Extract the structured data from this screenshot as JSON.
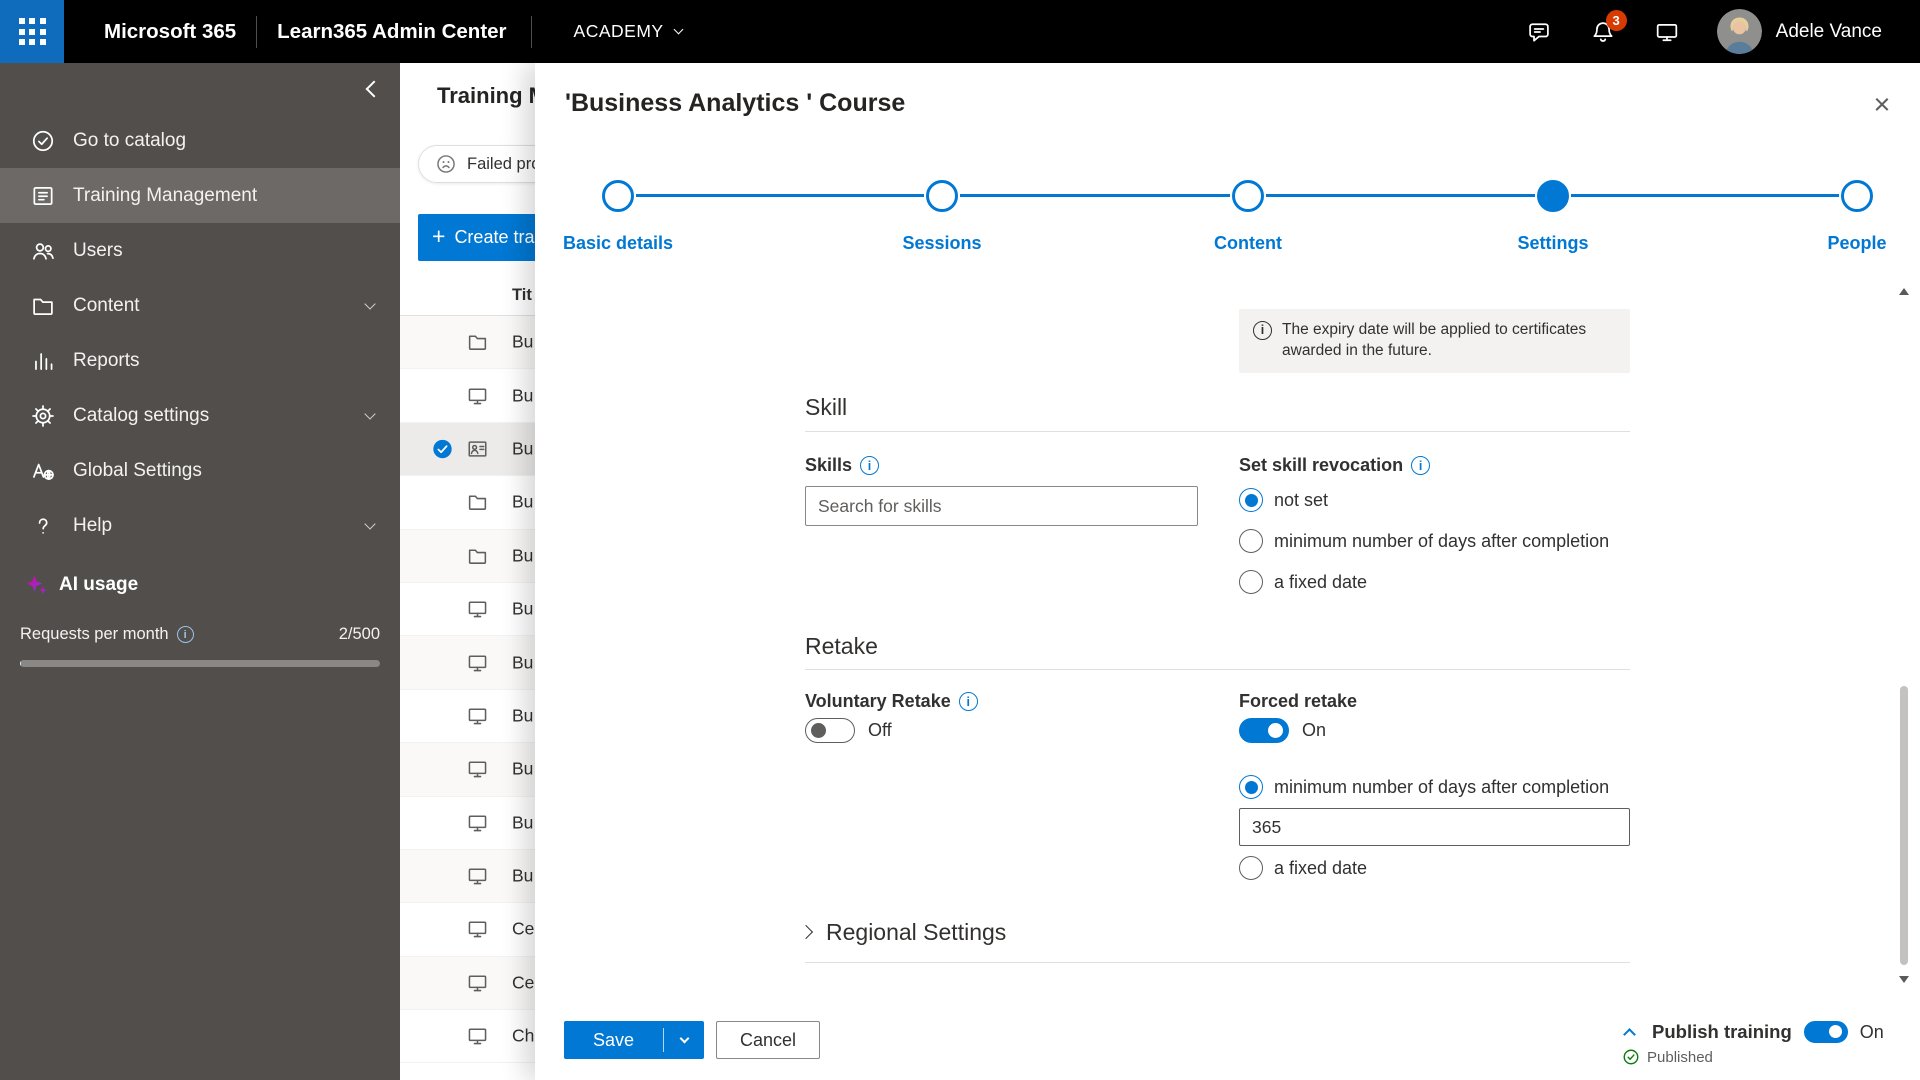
{
  "colors": {
    "accent": "#0078d4",
    "badge": "#d83b01",
    "success": "#107c10",
    "waffle": "#0f6cbd",
    "sidebar": "#514e4c",
    "sidebar_selected": "#6c6966",
    "topbar": "#000000",
    "ai_sparkle": "#e3008c"
  },
  "topbar": {
    "brand": "Microsoft 365",
    "app_title": "Learn365 Admin Center",
    "tenant": "ACADEMY",
    "actions": [
      {
        "icon": "chat-icon"
      },
      {
        "icon": "bell-icon",
        "badge": "3"
      },
      {
        "icon": "screen-share-icon"
      }
    ],
    "user_name": "Adele Vance"
  },
  "sidebar": {
    "items": [
      {
        "label": "Go to catalog",
        "icon": "catalog-icon",
        "selected": false,
        "chevron": false
      },
      {
        "label": "Training Management",
        "icon": "training-icon",
        "selected": true,
        "chevron": false
      },
      {
        "label": "Users",
        "icon": "users-icon",
        "selected": false,
        "chevron": false
      },
      {
        "label": "Content",
        "icon": "folder-icon",
        "selected": false,
        "chevron": true
      },
      {
        "label": "Reports",
        "icon": "reports-icon",
        "selected": false,
        "chevron": false
      },
      {
        "label": "Catalog settings",
        "icon": "gear-icon",
        "selected": false,
        "chevron": true
      },
      {
        "label": "Global Settings",
        "icon": "global-icon",
        "selected": false,
        "chevron": false
      },
      {
        "label": "Help",
        "icon": "help-icon",
        "selected": false,
        "chevron": true
      }
    ],
    "ai_usage": {
      "label": "AI usage",
      "icon": "sparkle-icon"
    },
    "requests": {
      "label": "Requests per month",
      "value": "2/500",
      "progress_pct": 0.4
    }
  },
  "list_panel": {
    "title": "Training M",
    "notice_text": "Failed pro",
    "create_button_label": "Create tra",
    "column_header": "Tit",
    "rows": [
      {
        "icon": "folder-icon",
        "text": "Bu",
        "selected": false
      },
      {
        "icon": "screen-icon",
        "text": "Bu",
        "selected": false
      },
      {
        "icon": "person-card-icon",
        "text": "Bu",
        "selected": true
      },
      {
        "icon": "folder-icon",
        "text": "Bu",
        "selected": false
      },
      {
        "icon": "folder-icon",
        "text": "Bu",
        "selected": false
      },
      {
        "icon": "screen-icon",
        "text": "Bu",
        "selected": false
      },
      {
        "icon": "screen-icon",
        "text": "Bu",
        "selected": false
      },
      {
        "icon": "screen-icon",
        "text": "Bu",
        "selected": false
      },
      {
        "icon": "screen-icon",
        "text": "Bu",
        "selected": false
      },
      {
        "icon": "screen-icon",
        "text": "Bu",
        "selected": false
      },
      {
        "icon": "screen-icon",
        "text": "Bu",
        "selected": false
      },
      {
        "icon": "screen-icon",
        "text": "Ce",
        "selected": false
      },
      {
        "icon": "screen-icon",
        "text": "Ce",
        "selected": false
      },
      {
        "icon": "screen-icon",
        "text": "Ch",
        "selected": false
      }
    ]
  },
  "dialog": {
    "title": "'Business Analytics ' Course",
    "steps": [
      {
        "label": "Basic details",
        "state": "done"
      },
      {
        "label": "Sessions",
        "state": "done"
      },
      {
        "label": "Content",
        "state": "done"
      },
      {
        "label": "Settings",
        "state": "current"
      },
      {
        "label": "People",
        "state": "todo"
      }
    ],
    "expiry_note": "The expiry date will be applied to certificates awarded in the future.",
    "skill": {
      "heading": "Skill",
      "skills_label": "Skills",
      "skills_placeholder": "Search for skills",
      "revocation_label": "Set skill revocation",
      "revocation_options": [
        {
          "label": "not set",
          "checked": true
        },
        {
          "label": "minimum number of days after completion",
          "checked": false
        },
        {
          "label": "a fixed date",
          "checked": false
        }
      ]
    },
    "retake": {
      "heading": "Retake",
      "voluntary_label": "Voluntary Retake",
      "voluntary_state": "Off",
      "forced_label": "Forced retake",
      "forced_state": "On",
      "forced_options": [
        {
          "label": "minimum number of days after completion",
          "checked": true,
          "input_value": "365"
        },
        {
          "label": "a fixed date",
          "checked": false
        }
      ]
    },
    "regional_heading": "Regional Settings",
    "footer": {
      "save_label": "Save",
      "cancel_label": "Cancel",
      "publish_label": "Publish training",
      "publish_state": "On",
      "published_status": "Published"
    }
  }
}
